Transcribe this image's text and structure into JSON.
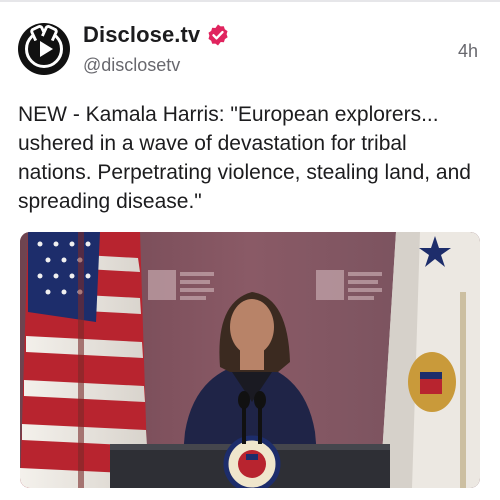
{
  "post": {
    "display_name": "Disclose.tv",
    "handle": "@disclosetv",
    "time_ago": "4h",
    "text": "NEW - Kamala Harris: \"European explorers... ushered in a wave of devastation for tribal nations. Perpetrating violence, stealing land, and spreading disease.\""
  },
  "icons": {
    "avatar": "disclosetv-logo-icon",
    "verified": "verified-badge-icon"
  },
  "colors": {
    "verified": "#e0245e",
    "text": "#1c1c1e",
    "secondary": "#68686e"
  },
  "media": {
    "backdrop_text": "National Congress of American Indians",
    "seal_text": "PRESIDENT OF THE UNITED STATES"
  }
}
